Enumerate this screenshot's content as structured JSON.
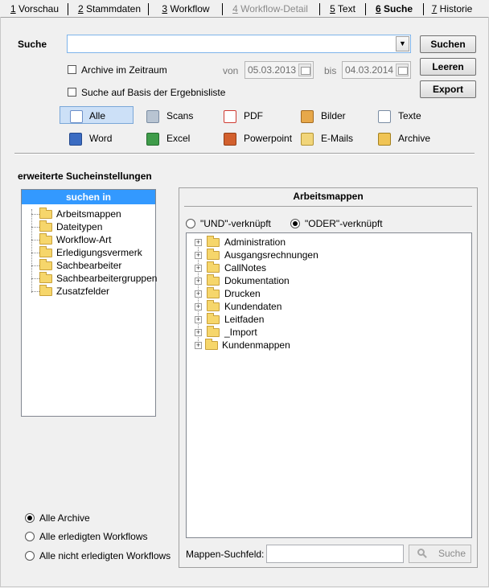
{
  "tabs": [
    {
      "num": "1",
      "label": "Vorschau",
      "state": "normal"
    },
    {
      "num": "2",
      "label": "Stammdaten",
      "state": "normal"
    },
    {
      "num": "3",
      "label": "Workflow",
      "state": "normal"
    },
    {
      "num": "4",
      "label": "Workflow-Detail",
      "state": "disabled"
    },
    {
      "num": "5",
      "label": "Text",
      "state": "normal"
    },
    {
      "num": "6",
      "label": "Suche",
      "state": "active"
    },
    {
      "num": "7",
      "label": "Historie",
      "state": "normal"
    }
  ],
  "search": {
    "label": "Suche",
    "value": "",
    "archive_zeitraum_label": "Archive im Zeitraum",
    "ergebnisliste_label": "Suche auf Basis der Ergebnisliste",
    "von_label": "von",
    "von_value": "05.03.2013",
    "bis_label": "bis",
    "bis_value": "04.03.2014",
    "dropdown_icon": "chevron-down-icon"
  },
  "buttons": {
    "suchen": "Suchen",
    "leeren": "Leeren",
    "export": "Export"
  },
  "file_types": [
    {
      "label": "Alle",
      "icon": "star-doc-icon",
      "selected": true
    },
    {
      "label": "Scans",
      "icon": "scanner-icon",
      "selected": false
    },
    {
      "label": "PDF",
      "icon": "pdf-icon",
      "selected": false
    },
    {
      "label": "Bilder",
      "icon": "image-icon",
      "selected": false
    },
    {
      "label": "Texte",
      "icon": "text-icon",
      "selected": false
    },
    {
      "label": "Word",
      "icon": "word-icon",
      "selected": false
    },
    {
      "label": "Excel",
      "icon": "excel-icon",
      "selected": false
    },
    {
      "label": "Powerpoint",
      "icon": "powerpoint-icon",
      "selected": false
    },
    {
      "label": "E-Mails",
      "icon": "email-icon",
      "selected": false
    },
    {
      "label": "Archive",
      "icon": "archive-icon",
      "selected": false
    }
  ],
  "advanced": {
    "title": "erweiterte Sucheinstellungen",
    "suchen_in_header": "suchen in",
    "suchen_in_items": [
      "Arbeitsmappen",
      "Dateitypen",
      "Workflow-Art",
      "Erledigungsvermerk",
      "Sachbearbeiter",
      "Sachbearbeitergruppen",
      "Zusatzfelder"
    ]
  },
  "arbeitsmappen": {
    "title": "Arbeitsmappen",
    "und_label": "\"UND\"-verknüpft",
    "oder_label": "\"ODER\"-verknüpft",
    "selected_mode": "oder",
    "folders": [
      "Administration",
      "Ausgangsrechnungen",
      "CallNotes",
      "Dokumentation",
      "Drucken",
      "Kundendaten",
      "Leitfaden",
      "_Import",
      "Kundenmappen"
    ],
    "suchfeld_label": "Mappen-Suchfeld:",
    "suchfeld_value": "",
    "suche_button": "Suche"
  },
  "scope": {
    "options": [
      "Alle Archive",
      "Alle erledigten Workflows",
      "Alle nicht erledigten Workflows"
    ],
    "selected": 0
  },
  "colors": {
    "accent": "#3399ff",
    "selection": "#cce0f7"
  }
}
